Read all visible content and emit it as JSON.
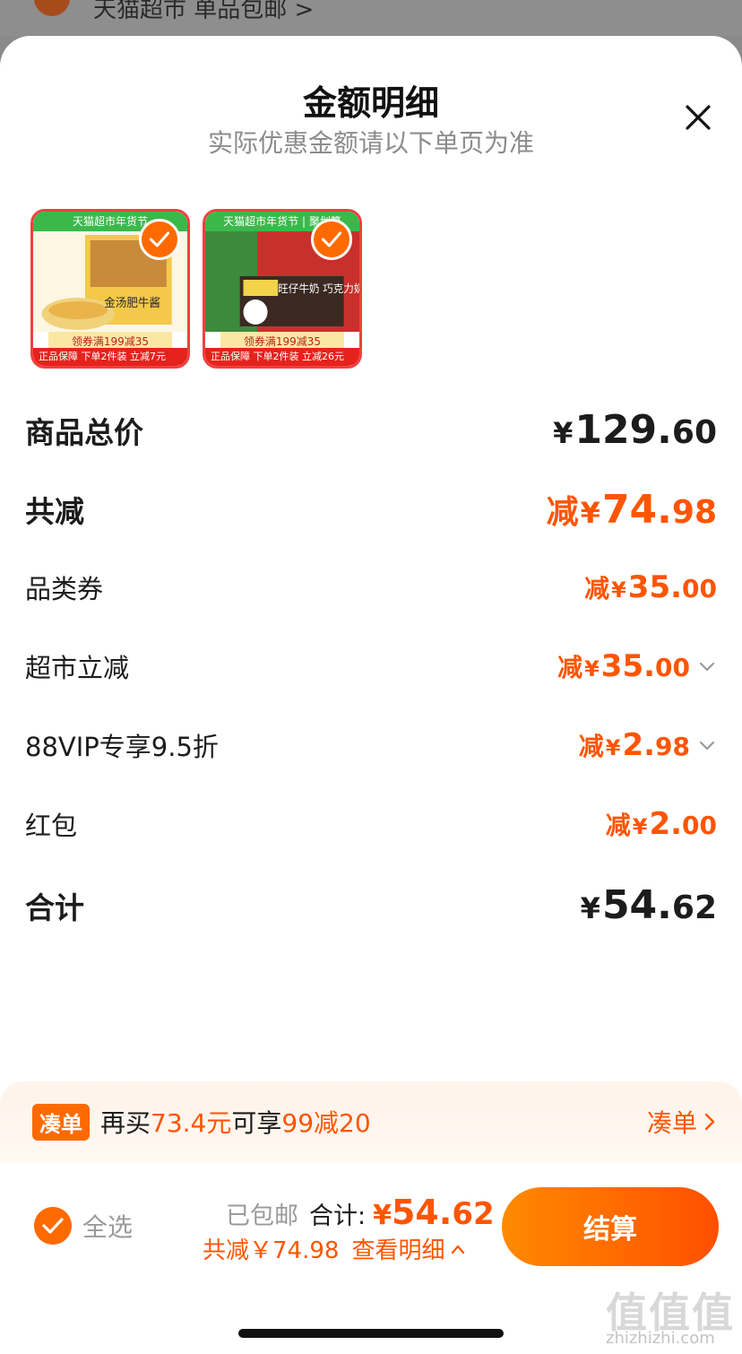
{
  "top": {
    "store_text": "天猫超市 单品包邮 >"
  },
  "header": {
    "title": "金额明细",
    "subtitle": "实际优惠金额请以下单页为准"
  },
  "products": [
    {
      "banner": "天猫超市年货节",
      "coupon": "领券满199减35",
      "promo": "正品保障  下单2件装 立减7元",
      "name": "金汤肥牛酱"
    },
    {
      "banner": "天猫超市年货节 | 聚划算",
      "coupon": "领券满199减35",
      "promo": "正品保障  下单2件装 立减26元",
      "name": "旺仔牛奶 巧克力奶"
    }
  ],
  "rows": {
    "subtotal": {
      "label": "商品总价",
      "yen": "¥",
      "int": "129.",
      "dec": "60"
    },
    "discount_total": {
      "label": "共减",
      "prefix": "减",
      "yen": "¥",
      "int": "74.",
      "dec": "98"
    },
    "category_coupon": {
      "label": "品类券",
      "prefix": "减",
      "yen": "¥",
      "int": "35.",
      "dec": "00"
    },
    "store_discount": {
      "label": "超市立减",
      "prefix": "减",
      "yen": "¥",
      "int": "35.",
      "dec": "00"
    },
    "vip_discount": {
      "label": "88VIP专享9.5折",
      "prefix": "减",
      "yen": "¥",
      "int": "2.",
      "dec": "98"
    },
    "red_packet": {
      "label": "红包",
      "prefix": "减",
      "yen": "¥",
      "int": "2.",
      "dec": "00"
    },
    "total": {
      "label": "合计",
      "yen": "¥",
      "int": "54.",
      "dec": "62"
    }
  },
  "cod": {
    "tag": "凑单",
    "text_pre": "再买",
    "text_amount": "73.4元",
    "text_mid": "可享",
    "text_offer": "99减20",
    "link": "凑单"
  },
  "footer": {
    "select_all": "全选",
    "free_shipping": "已包邮",
    "total_label": "合计:",
    "total_yen": "¥",
    "total_int": "54.",
    "total_dec": "62",
    "savings": "共减￥74.98",
    "view_detail": "查看明细",
    "pay_button": "结算"
  },
  "watermark": {
    "logo": "值值值",
    "site": "zhizhizhi.com"
  },
  "colors": {
    "accent": "#ff5500",
    "check": "#ff6a00",
    "pay_gradient_start": "#ff8a00",
    "pay_gradient_end": "#ff4f00"
  }
}
